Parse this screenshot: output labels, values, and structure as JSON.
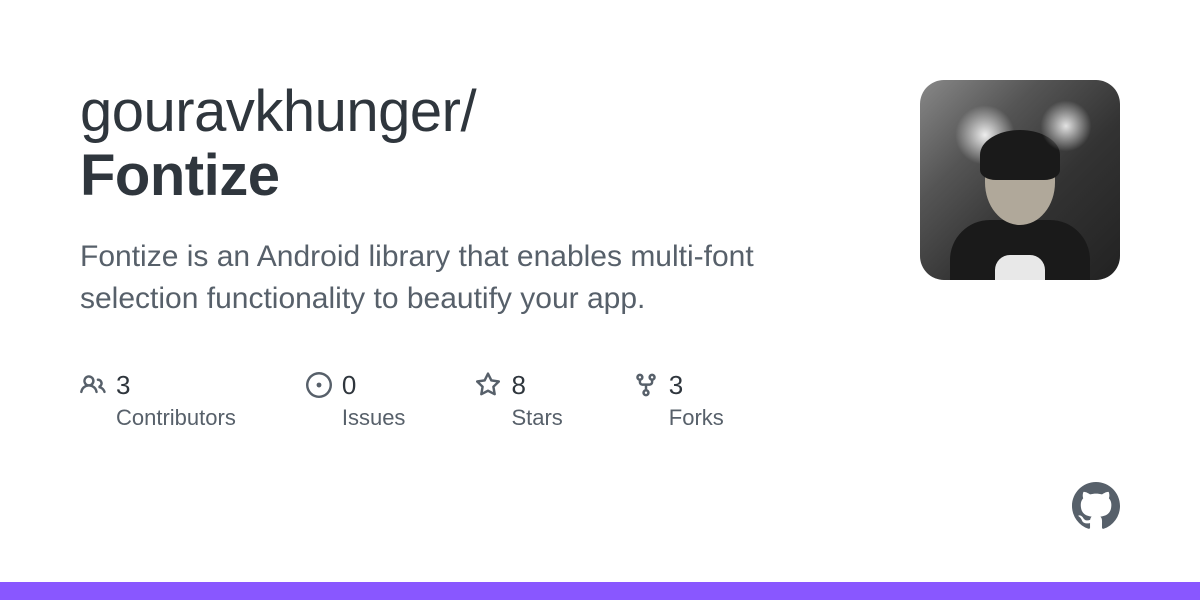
{
  "repo": {
    "owner": "gouravkhunger",
    "separator": "/",
    "name": "Fontize",
    "description": "Fontize is an Android library that enables multi-font selection functionality to beautify your app."
  },
  "stats": {
    "contributors": {
      "count": "3",
      "label": "Contributors"
    },
    "issues": {
      "count": "0",
      "label": "Issues"
    },
    "stars": {
      "count": "8",
      "label": "Stars"
    },
    "forks": {
      "count": "3",
      "label": "Forks"
    }
  },
  "colors": {
    "accent": "#8957ff"
  }
}
